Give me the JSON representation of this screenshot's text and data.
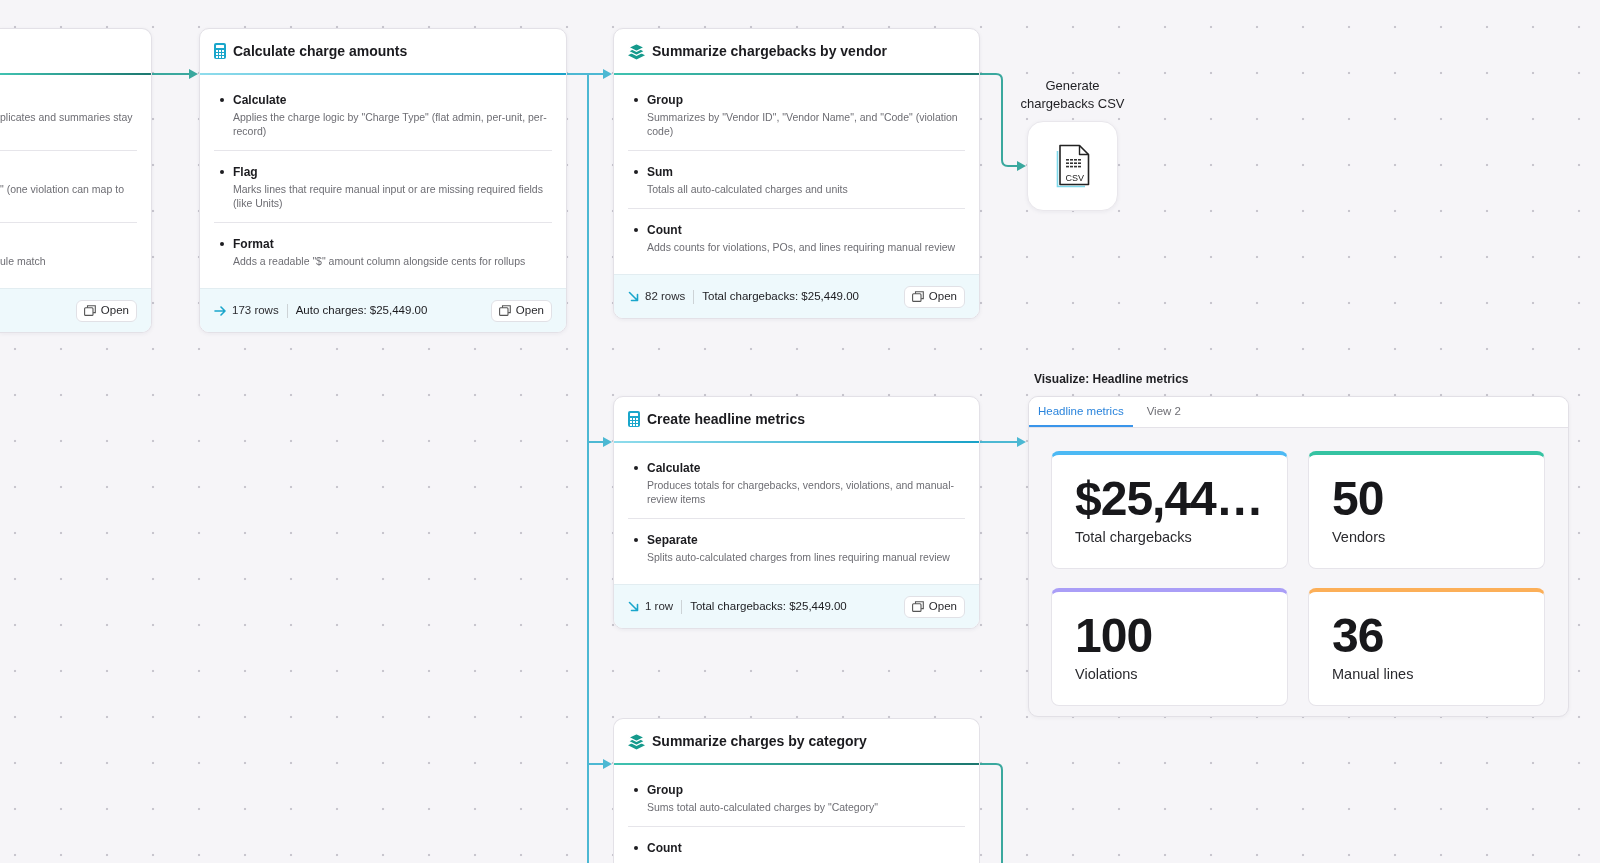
{
  "nodes": [
    {
      "kind": "summarize",
      "items": [
        {
          "description": "plicates and summaries stay"
        },
        {
          "description": "\" (one violation can map to"
        },
        {
          "description": "ule match"
        }
      ],
      "footer": {
        "button": "Open"
      }
    },
    {
      "kind": "calculate",
      "title": "Calculate charge amounts",
      "items": [
        {
          "label": "Calculate",
          "description": "Applies the charge logic by \"Charge Type\" (flat admin, per-unit, per-record)"
        },
        {
          "label": "Flag",
          "description": "Marks lines that require manual input or are missing required fields (like Units)"
        },
        {
          "label": "Format",
          "description": "Adds a readable \"$\" amount column alongside cents for rollups"
        }
      ],
      "footer": {
        "kind": "passthrough",
        "rows": "173 rows",
        "summary": "Auto charges: $25,449.00",
        "button": "Open"
      }
    },
    {
      "kind": "summarize",
      "title": "Summarize chargebacks by vendor",
      "items": [
        {
          "label": "Group",
          "description": "Summarizes by \"Vendor ID\", \"Vendor Name\", and \"Code\" (violation code)"
        },
        {
          "label": "Sum",
          "description": "Totals all auto-calculated charges and units"
        },
        {
          "label": "Count",
          "description": "Adds counts for violations, POs, and lines requiring manual review"
        }
      ],
      "footer": {
        "kind": "reduced",
        "rows": "82 rows",
        "summary": "Total chargebacks: $25,449.00",
        "button": "Open"
      }
    },
    {
      "kind": "calculate",
      "title": "Create headline metrics",
      "items": [
        {
          "label": "Calculate",
          "description": "Produces totals for chargebacks, vendors, violations, and manual-review items"
        },
        {
          "label": "Separate",
          "description": "Splits auto-calculated charges from lines requiring manual review"
        }
      ],
      "footer": {
        "kind": "reduced",
        "rows": "1 row",
        "summary": "Total chargebacks: $25,449.00",
        "button": "Open"
      }
    },
    {
      "kind": "summarize",
      "title": "Summarize charges by category",
      "items": [
        {
          "label": "Group",
          "description": "Sums total auto-calculated charges by \"Category\""
        },
        {
          "label": "Count"
        }
      ]
    }
  ],
  "csv_node": {
    "label": "Generate chargebacks CSV",
    "file_type": "CSV"
  },
  "panel": {
    "title": "Visualize: Headline metrics",
    "tabs": [
      {
        "label": "Headline metrics",
        "selected": true
      },
      {
        "label": "View 2",
        "selected": false
      }
    ],
    "metrics": [
      {
        "value": "$25,44…",
        "label": "Total chargebacks",
        "color": "#4cb9f4"
      },
      {
        "value": "50",
        "label": "Vendors",
        "color": "#35c3a2"
      },
      {
        "value": "100",
        "label": "Violations",
        "color": "#aa9ef7"
      },
      {
        "value": "36",
        "label": "Manual lines",
        "color": "#fcaf58"
      }
    ]
  }
}
